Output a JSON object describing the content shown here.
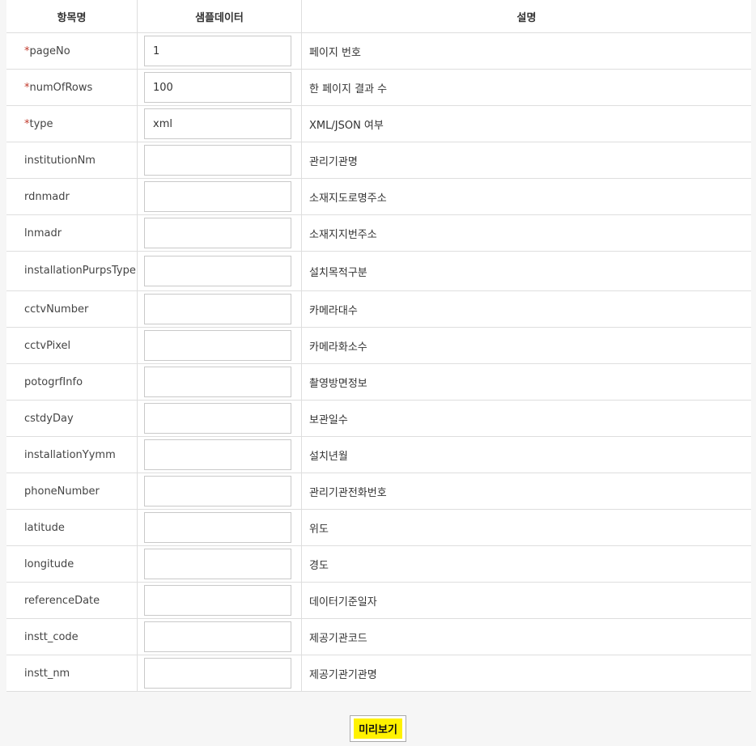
{
  "headers": {
    "item": "항목명",
    "sample": "샘플데이터",
    "desc": "설명"
  },
  "rows": [
    {
      "required": true,
      "name": "pageNo",
      "value": "1",
      "desc": "페이지 번호"
    },
    {
      "required": true,
      "name": "numOfRows",
      "value": "100",
      "desc": "한 페이지 결과 수"
    },
    {
      "required": true,
      "name": "type",
      "value": "xml",
      "desc": "XML/JSON 여부"
    },
    {
      "required": false,
      "name": "institutionNm",
      "value": "",
      "desc": "관리기관명"
    },
    {
      "required": false,
      "name": "rdnmadr",
      "value": "",
      "desc": "소재지도로명주소"
    },
    {
      "required": false,
      "name": "lnmadr",
      "value": "",
      "desc": "소재지지번주소"
    },
    {
      "required": false,
      "name": "installationPurpsType",
      "value": "",
      "desc": "설치목적구분"
    },
    {
      "required": false,
      "name": "cctvNumber",
      "value": "",
      "desc": "카메라대수"
    },
    {
      "required": false,
      "name": "cctvPixel",
      "value": "",
      "desc": "카메라화소수"
    },
    {
      "required": false,
      "name": "potogrfInfo",
      "value": "",
      "desc": "촬영방면정보"
    },
    {
      "required": false,
      "name": "cstdyDay",
      "value": "",
      "desc": "보관일수"
    },
    {
      "required": false,
      "name": "installationYymm",
      "value": "",
      "desc": "설치년월"
    },
    {
      "required": false,
      "name": "phoneNumber",
      "value": "",
      "desc": "관리기관전화번호"
    },
    {
      "required": false,
      "name": "latitude",
      "value": "",
      "desc": "위도"
    },
    {
      "required": false,
      "name": "longitude",
      "value": "",
      "desc": "경도"
    },
    {
      "required": false,
      "name": "referenceDate",
      "value": "",
      "desc": "데이터기준일자"
    },
    {
      "required": false,
      "name": "instt_code",
      "value": "",
      "desc": "제공기관코드"
    },
    {
      "required": false,
      "name": "instt_nm",
      "value": "",
      "desc": "제공기관기관명"
    }
  ],
  "required_marker": "*",
  "preview_button": "미리보기"
}
